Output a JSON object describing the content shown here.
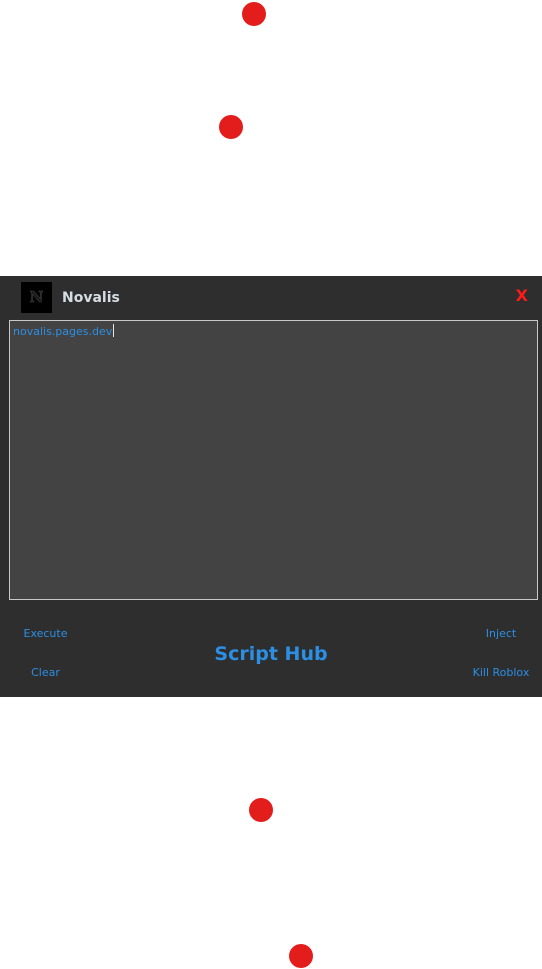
{
  "window": {
    "title": "Novalis",
    "logo_letter": "N",
    "close_label": "X"
  },
  "editor": {
    "text": "novalis.pages.dev"
  },
  "buttons": {
    "execute": "Execute",
    "clear": "Clear",
    "inject": "Inject",
    "kill_roblox": "Kill Roblox",
    "script_hub": "Script Hub"
  },
  "colors": {
    "accent": "#2c8fe4",
    "close": "#ff1a1a",
    "panel": "#2e2e2e",
    "editor_bg": "#434343",
    "dots": "#e31c1c"
  },
  "icons": {
    "logo": "novalis-logo-icon",
    "dots": "red-dot-icon"
  }
}
